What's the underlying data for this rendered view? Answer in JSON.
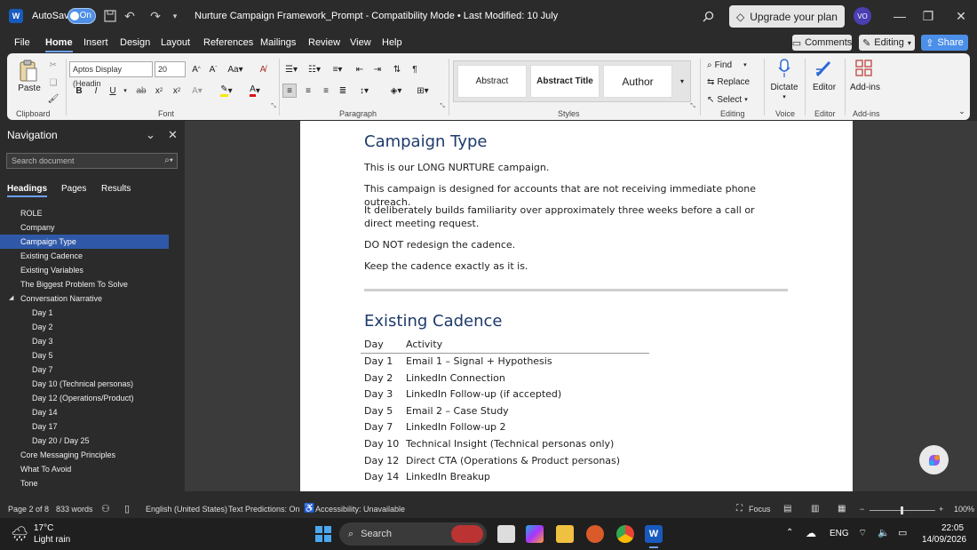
{
  "titlebar": {
    "autosave_label": "AutoSave",
    "autosave_state": "On",
    "doc_title": "Nurture Campaign Framework_Prompt  -  Compatibility Mode  •  Last Modified: 10 July",
    "upgrade_label": "Upgrade your plan",
    "avatar_initials": "VO"
  },
  "menu": {
    "items": [
      "File",
      "Home",
      "Insert",
      "Design",
      "Layout",
      "References",
      "Mailings",
      "Review",
      "View",
      "Help"
    ],
    "active": "Home",
    "comments_label": "Comments",
    "editing_label": "Editing",
    "share_label": "Share"
  },
  "ribbon": {
    "clipboard": {
      "paste_label": "Paste",
      "group_label": "Clipboard"
    },
    "font": {
      "font_name": "Aptos Display (Headin",
      "font_size": "20",
      "group_label": "Font"
    },
    "paragraph": {
      "group_label": "Paragraph"
    },
    "styles": {
      "cards": [
        "Abstract",
        "Abstract Title",
        "Author"
      ],
      "group_label": "Styles"
    },
    "editing": {
      "find_label": "Find",
      "replace_label": "Replace",
      "select_label": "Select",
      "group_label": "Editing"
    },
    "voice": {
      "dictate_label": "Dictate",
      "group_label": "Voice"
    },
    "editor": {
      "editor_label": "Editor",
      "group_label": "Editor"
    },
    "addins": {
      "addins_label": "Add-ins",
      "group_label": "Add-ins"
    }
  },
  "navigation": {
    "title": "Navigation",
    "search_placeholder": "Search document",
    "tabs": [
      "Headings",
      "Pages",
      "Results"
    ],
    "active_tab": "Headings",
    "items": [
      {
        "label": "ROLE",
        "level": 1
      },
      {
        "label": "Company",
        "level": 1
      },
      {
        "label": "Campaign Type",
        "level": 1,
        "selected": true
      },
      {
        "label": "Existing Cadence",
        "level": 1
      },
      {
        "label": "Existing Variables",
        "level": 1
      },
      {
        "label": "The Biggest Problem To Solve",
        "level": 1
      },
      {
        "label": "Conversation Narrative",
        "level": 1,
        "expanded": true
      },
      {
        "label": "Day 1",
        "level": 2
      },
      {
        "label": "Day 2",
        "level": 2
      },
      {
        "label": "Day 3",
        "level": 2
      },
      {
        "label": "Day 5",
        "level": 2
      },
      {
        "label": "Day 7",
        "level": 2
      },
      {
        "label": "Day 10 (Technical personas)",
        "level": 2
      },
      {
        "label": "Day 12 (Operations/Product)",
        "level": 2
      },
      {
        "label": "Day 14",
        "level": 2
      },
      {
        "label": "Day 17",
        "level": 2
      },
      {
        "label": "Day 20 / Day 25",
        "level": 2
      },
      {
        "label": "Core Messaging Principles",
        "level": 1
      },
      {
        "label": "What To Avoid",
        "level": 1
      },
      {
        "label": "Tone",
        "level": 1
      }
    ]
  },
  "document": {
    "heading1": "Campaign Type",
    "paragraphs": [
      "This is our LONG NURTURE campaign.",
      "This campaign is designed for accounts that are not receiving immediate phone outreach.",
      "It deliberately builds familiarity over approximately three weeks before a call or direct meeting request.",
      "DO NOT redesign the cadence.",
      "Keep the cadence exactly as it is."
    ],
    "heading2": "Existing Cadence",
    "table_headers": [
      "Day",
      "Activity"
    ],
    "table_rows": [
      [
        "Day 1",
        "Email 1 – Signal + Hypothesis"
      ],
      [
        "Day 2",
        "LinkedIn Connection"
      ],
      [
        "Day 3",
        "LinkedIn Follow-up (if accepted)"
      ],
      [
        "Day 5",
        "Email 2 – Case Study"
      ],
      [
        "Day 7",
        "LinkedIn Follow-up 2"
      ],
      [
        "Day 10",
        "Technical Insight (Technical personas only)"
      ],
      [
        "Day 12",
        "Direct CTA (Operations & Product personas)"
      ],
      [
        "Day 14",
        "LinkedIn Breakup"
      ]
    ]
  },
  "status": {
    "page": "Page 2 of 8",
    "words": "833 words",
    "language": "English (United States)",
    "predictions": "Text Predictions: On",
    "accessibility": "Accessibility: Unavailable",
    "focus": "Focus",
    "zoom": "100%"
  },
  "taskbar": {
    "temp": "17°C",
    "weather": "Light rain",
    "search_label": "Search",
    "lang": "ENG",
    "time": "22:05",
    "date": "14/09/2026"
  },
  "colors": {
    "accent": "#185abd",
    "heading": "#1d3a6b",
    "nav_selected": "#2f59a8",
    "share": "#4c8fe8"
  }
}
